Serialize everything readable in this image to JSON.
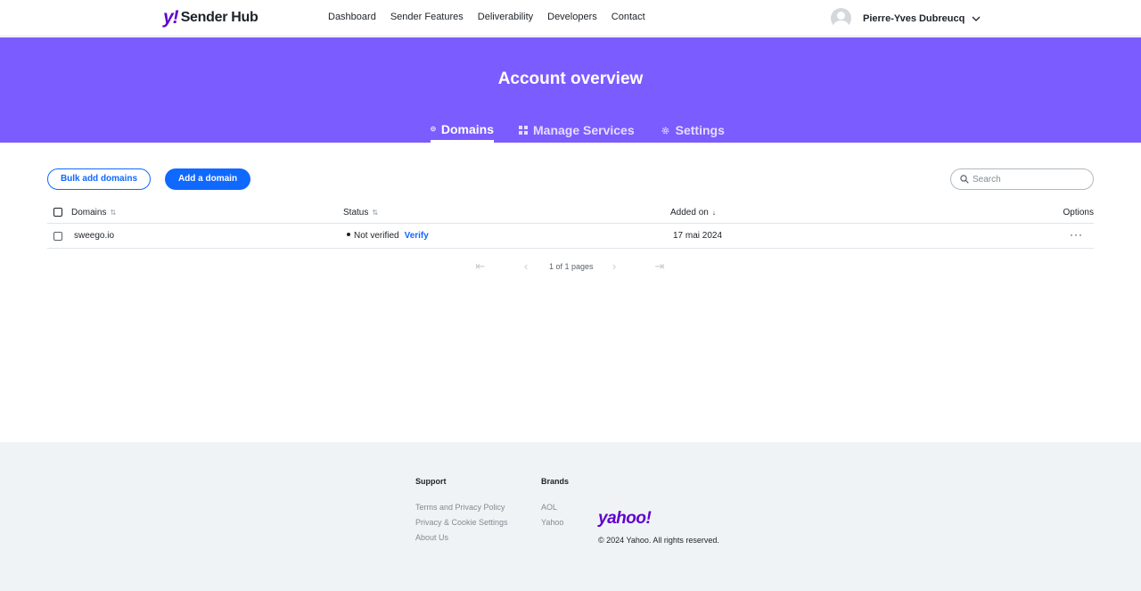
{
  "header": {
    "logo_mark": "y!",
    "logo_text": "Sender Hub",
    "nav": [
      "Dashboard",
      "Sender Features",
      "Deliverability",
      "Developers",
      "Contact"
    ],
    "user_name": "Pierre-Yves Dubreucq"
  },
  "hero": {
    "title": "Account overview",
    "tabs": [
      {
        "label": "Domains",
        "icon": "globe-icon",
        "active": true
      },
      {
        "label": "Manage Services",
        "icon": "grid-icon",
        "active": false
      },
      {
        "label": "Settings",
        "icon": "gear-icon",
        "active": false
      }
    ],
    "background": "#7b5cff"
  },
  "toolbar": {
    "bulk_add_label": "Bulk add domains",
    "add_domain_label": "Add a domain",
    "search_placeholder": "Search"
  },
  "table": {
    "columns": {
      "domains": "Domains",
      "status": "Status",
      "added_on": "Added on",
      "options": "Options"
    },
    "rows": [
      {
        "domain": "sweego.io",
        "status": "Not verified",
        "action": "Verify",
        "added_on": "17 mai 2024"
      }
    ]
  },
  "pagination": {
    "text": "1 of 1 pages"
  },
  "footer": {
    "support_heading": "Support",
    "support_links": [
      "Terms and Privacy Policy",
      "Privacy & Cookie Settings",
      "About Us"
    ],
    "brands_heading": "Brands",
    "brands_links": [
      "AOL",
      "Yahoo"
    ],
    "logo": "yahoo!",
    "copyright": "© 2024 Yahoo. All rights reserved."
  },
  "colors": {
    "brand_purple": "#6001d2",
    "hero_purple": "#7b5cff",
    "primary_blue": "#0f69ff"
  }
}
